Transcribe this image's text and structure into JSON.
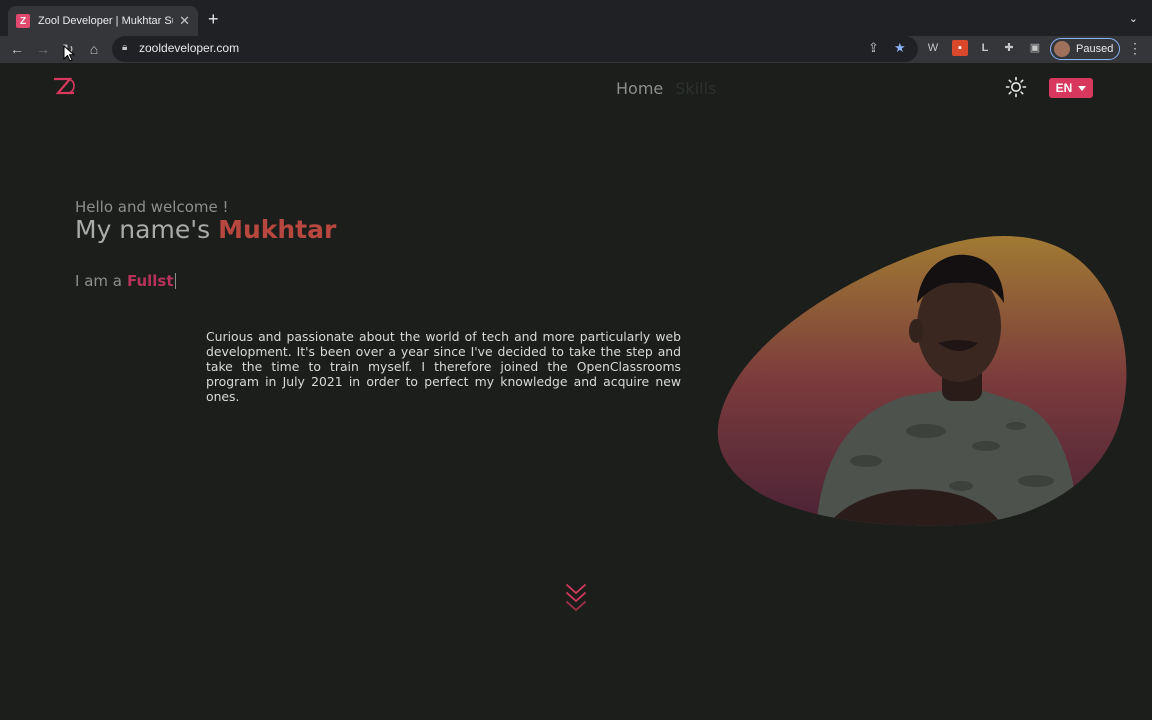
{
  "browser": {
    "tab_title": "Zool Developer | Mukhtar Sula",
    "favicon_letter": "Z",
    "url": "zooldeveloper.com",
    "profile_label": "Paused",
    "ext_w": "W",
    "ext_l": "L"
  },
  "site": {
    "nav": {
      "home": "Home",
      "skills": "Skills"
    },
    "lang": "EN",
    "hero": {
      "greeting": "Hello and welcome !",
      "name_prefix": "My name's ",
      "name": "Mukhtar",
      "role_prefix": "I am a",
      "role_typed": "Fullst",
      "bio": "Curious and passionate about the world of tech and more particularly web development. It's been over a year since I've decided to take the step and take the time to train myself. I therefore joined the OpenClassrooms program in July 2021 in order to perfect my knowledge and acquire new ones."
    }
  },
  "colors": {
    "accent": "#d9385e",
    "name_highlight": "#b8473f",
    "typed_role": "#b7325b",
    "background": "#1b1e1b"
  }
}
